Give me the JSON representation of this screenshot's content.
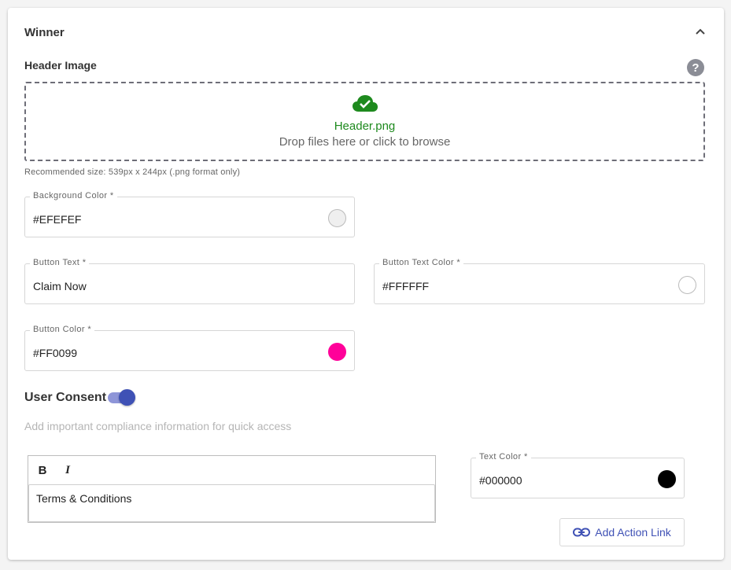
{
  "section": {
    "title": "Winner"
  },
  "header_image": {
    "label": "Header Image",
    "file_name": "Header.png",
    "drop_hint": "Drop files here or click to browse",
    "recommendation": "Recommended size: 539px x 244px (.png format only)"
  },
  "fields": {
    "background_color": {
      "label": "Background Color *",
      "value": "#EFEFEF",
      "swatch": "#EFEFEF"
    },
    "button_text": {
      "label": "Button Text *",
      "value": "Claim Now"
    },
    "button_text_color": {
      "label": "Button Text Color *",
      "value": "#FFFFFF",
      "swatch": "#FFFFFF"
    },
    "button_color": {
      "label": "Button Color *",
      "value": "#FF0099",
      "swatch": "#FF0099"
    },
    "text_color": {
      "label": "Text Color *",
      "value": "#000000",
      "swatch": "#000000"
    }
  },
  "consent": {
    "label": "User Consent",
    "enabled": true,
    "description": "Add important compliance information for quick access",
    "editor": {
      "bold_label": "B",
      "italic_label": "I",
      "content": "Terms & Conditions"
    },
    "action_link_label": "Add Action Link"
  },
  "colors": {
    "accent": "#3f51b5",
    "success": "#1e8a1e"
  },
  "icons": [
    "chevron-up-icon",
    "help-icon",
    "cloud-check-icon",
    "link-icon"
  ]
}
